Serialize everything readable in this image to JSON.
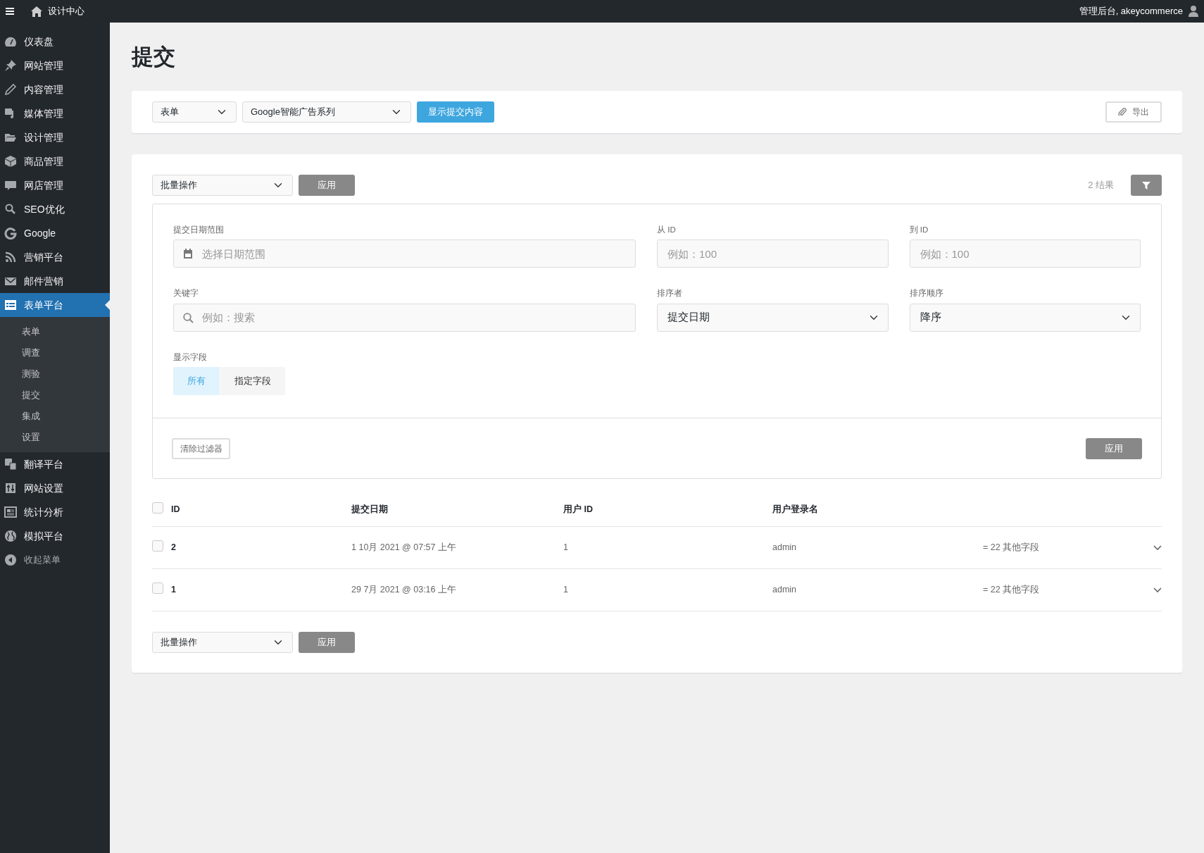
{
  "topbar": {
    "site_title": "设计中心",
    "greeting": "管理后台, akeycommerce"
  },
  "sidebar": {
    "items": [
      {
        "label": "仪表盘",
        "kind": "main",
        "selected": false
      },
      {
        "label": "网站管理",
        "kind": "main",
        "selected": false
      },
      {
        "label": "内容管理",
        "kind": "main",
        "selected": false
      },
      {
        "label": "媒体管理",
        "kind": "main",
        "selected": false
      },
      {
        "label": "设计管理",
        "kind": "main",
        "selected": false
      },
      {
        "label": "商品管理",
        "kind": "main",
        "selected": false
      },
      {
        "label": "网店管理",
        "kind": "main",
        "selected": false
      },
      {
        "label": "SEO优化",
        "kind": "main",
        "selected": false
      },
      {
        "label": "Google",
        "kind": "main",
        "selected": false
      },
      {
        "label": "营销平台",
        "kind": "main",
        "selected": false
      },
      {
        "label": "邮件营销",
        "kind": "main",
        "selected": false
      },
      {
        "label": "表单平台",
        "kind": "main",
        "selected": true,
        "children": [
          {
            "label": "表单",
            "selected": false
          },
          {
            "label": "调查",
            "selected": false
          },
          {
            "label": "测验",
            "selected": false
          },
          {
            "label": "提交",
            "selected": false
          },
          {
            "label": "集成",
            "selected": false
          },
          {
            "label": "设置",
            "selected": false
          }
        ]
      },
      {
        "label": "翻译平台",
        "kind": "main",
        "selected": false
      },
      {
        "label": "网站设置",
        "kind": "main",
        "selected": false
      },
      {
        "label": "统计分析",
        "kind": "main",
        "selected": false
      },
      {
        "label": "模拟平台",
        "kind": "main",
        "selected": false
      },
      {
        "label": "收起菜单",
        "kind": "collapse",
        "selected": false
      }
    ]
  },
  "page_title": "提交",
  "toolbar": {
    "form_type": "表单",
    "form": "Google智能广告系列",
    "show_button": "显示提交内容",
    "export_button": "导出"
  },
  "bulk_actions_top": {
    "select": "批量操作",
    "apply": "应用"
  },
  "results_count": "2 结果",
  "filters": {
    "date_range": {
      "label": "提交日期范围",
      "placeholder": "选择日期范围"
    },
    "from_id": {
      "label": "从 ID",
      "placeholder": "例如：100"
    },
    "to_id": {
      "label": "到 ID",
      "placeholder": "例如：100"
    },
    "keyword": {
      "label": "关键字",
      "placeholder": "例如：搜索"
    },
    "sort_by": {
      "label": "排序者",
      "value": "提交日期"
    },
    "sort_order": {
      "label": "排序顺序",
      "value": "降序"
    },
    "show_fields": {
      "label": "显示字段",
      "options": [
        {
          "label": "所有",
          "selected": true
        },
        {
          "label": "指定字段",
          "selected": false
        }
      ]
    },
    "clear_button": "清除过滤器",
    "apply_button": "应用"
  },
  "table": {
    "select_all_checked": false,
    "columns": [
      "ID",
      "提交日期",
      "用户 ID",
      "用户登录名"
    ],
    "rows": [
      {
        "checked": false,
        "id": "2",
        "date": "1 10月 2021 @ 07:57 上午",
        "user_id": "1",
        "user_login": "admin",
        "other_fields": "= 22 其他字段",
        "expanded": false
      },
      {
        "checked": false,
        "id": "1",
        "date": "29 7月 2021 @ 03:16 上午",
        "user_id": "1",
        "user_login": "admin",
        "other_fields": "= 22 其他字段",
        "expanded": false
      }
    ]
  },
  "bulk_actions_bottom": {
    "select": "批量操作",
    "apply": "应用"
  }
}
